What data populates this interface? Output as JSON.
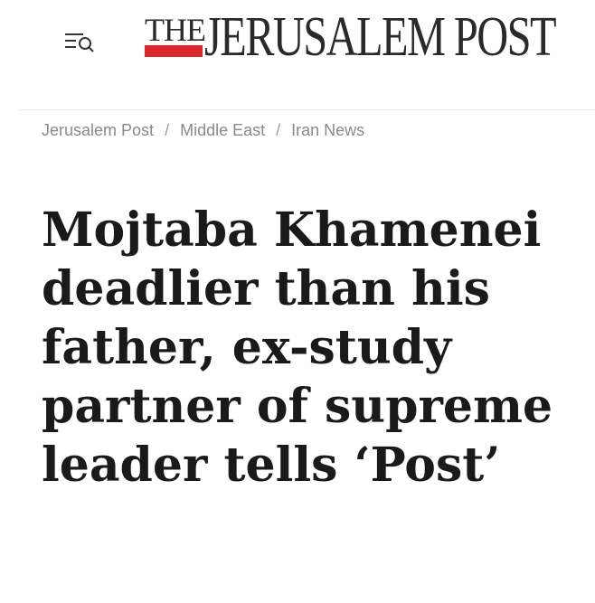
{
  "header": {
    "logo_the": "THE",
    "logo_name": "JERUSALEM POST",
    "menu_icon": "menu-search-icon",
    "accent_color": "#d9262c"
  },
  "breadcrumb": {
    "items": [
      "Jerusalem Post",
      "Middle East",
      "Iran News"
    ],
    "separator": "/"
  },
  "article": {
    "headline_lines": [
      "Mojtaba Khamenei",
      "deadlier than his",
      "father, ex-study",
      "partner of supreme",
      "leader tells ‘Post’"
    ]
  }
}
